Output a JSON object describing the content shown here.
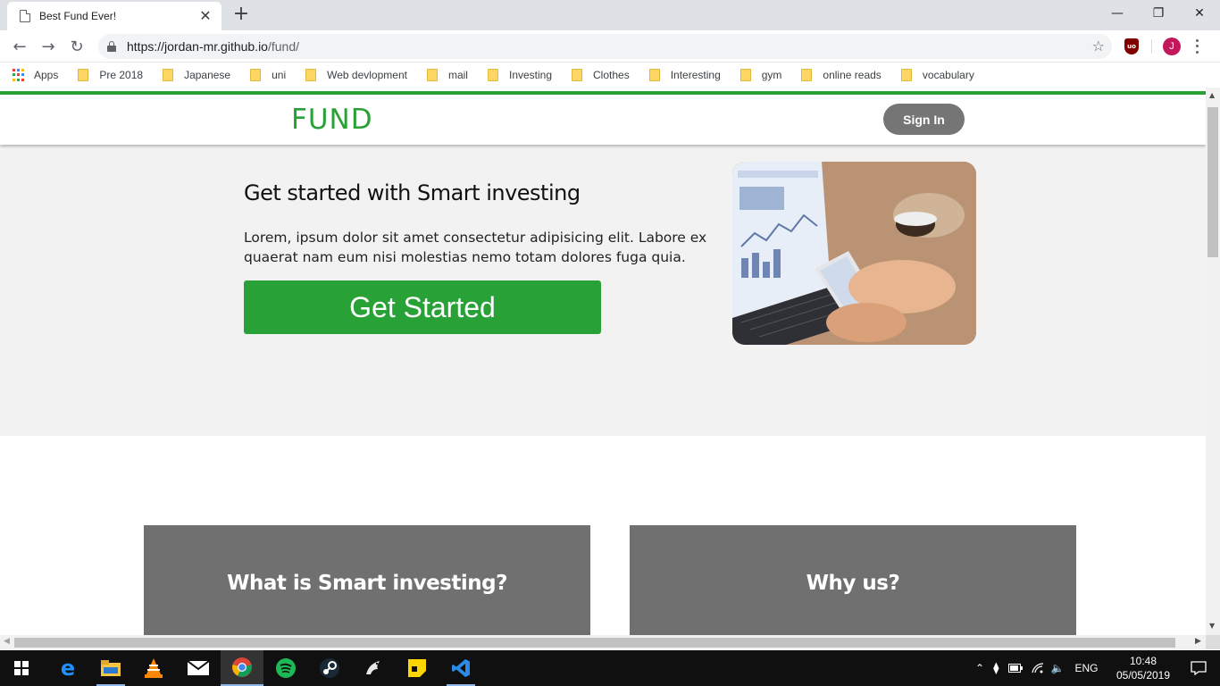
{
  "browser": {
    "tab_title": "Best Fund Ever!",
    "url_host": "https://jordan-mr.github.io",
    "url_path": "/fund/",
    "avatar_initial": "J",
    "ublock_label": "uo"
  },
  "bookmarks": {
    "apps_label": "Apps",
    "folders": [
      "Pre 2018",
      "Japanese",
      "uni",
      "Web devlopment",
      "mail",
      "Investing",
      "Clothes",
      "Interesting",
      "gym",
      "online reads",
      "vocabulary"
    ]
  },
  "site": {
    "logo": "FUND",
    "signin_label": "Sign In",
    "hero_title": "Get started with Smart investing",
    "hero_text": "Lorem, ipsum dolor sit amet consectetur adipisicing elit. Labore ex quaerat nam eum nisi molestias nemo totam dolores fuga quia.",
    "cta_label": "Get Started",
    "cards": [
      {
        "title": "What is Smart investing?"
      },
      {
        "title": "Why us?"
      }
    ]
  },
  "taskbar": {
    "time": "10:48",
    "date": "05/05/2019",
    "language": "ENG"
  },
  "colors": {
    "brand_green": "#28a236",
    "card_gray": "#707070",
    "hero_bg": "#f2f2f2"
  }
}
